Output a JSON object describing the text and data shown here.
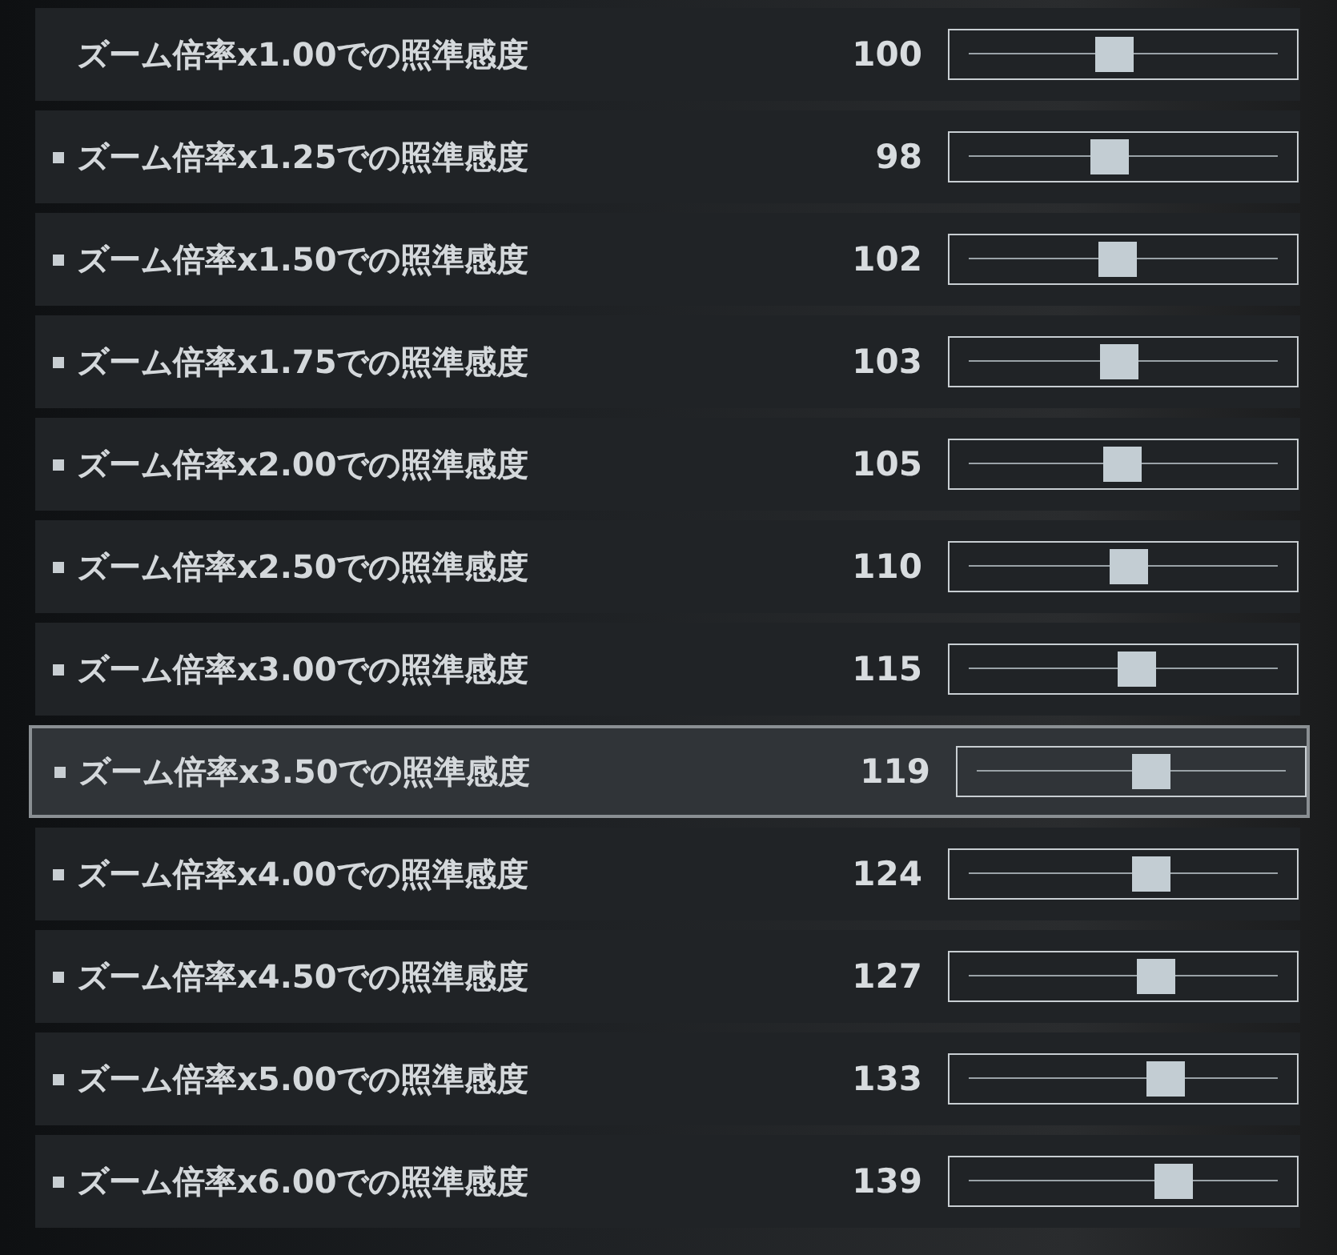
{
  "settings": [
    {
      "label": "ズーム倍率x1.00での照準感度",
      "marked": false,
      "value": "100",
      "level": 0.47,
      "selected": false
    },
    {
      "label": "ズーム倍率x1.25での照準感度",
      "marked": true,
      "value": "98",
      "level": 0.455,
      "selected": false
    },
    {
      "label": "ズーム倍率x1.50での照準感度",
      "marked": true,
      "value": "102",
      "level": 0.48,
      "selected": false
    },
    {
      "label": "ズーム倍率x1.75での照準感度",
      "marked": true,
      "value": "103",
      "level": 0.485,
      "selected": false
    },
    {
      "label": "ズーム倍率x2.00での照準感度",
      "marked": true,
      "value": "105",
      "level": 0.495,
      "selected": false
    },
    {
      "label": "ズーム倍率x2.50での照準感度",
      "marked": true,
      "value": "110",
      "level": 0.52,
      "selected": false
    },
    {
      "label": "ズーム倍率x3.00での照準感度",
      "marked": true,
      "value": "115",
      "level": 0.545,
      "selected": false
    },
    {
      "label": "ズーム倍率x3.50での照準感度",
      "marked": true,
      "value": "119",
      "level": 0.565,
      "selected": true
    },
    {
      "label": "ズーム倍率x4.00での照準感度",
      "marked": true,
      "value": "124",
      "level": 0.59,
      "selected": false
    },
    {
      "label": "ズーム倍率x4.50での照準感度",
      "marked": true,
      "value": "127",
      "level": 0.605,
      "selected": false
    },
    {
      "label": "ズーム倍率x5.00での照準感度",
      "marked": true,
      "value": "133",
      "level": 0.635,
      "selected": false
    },
    {
      "label": "ズーム倍率x6.00での照準感度",
      "marked": true,
      "value": "139",
      "level": 0.665,
      "selected": false
    }
  ]
}
